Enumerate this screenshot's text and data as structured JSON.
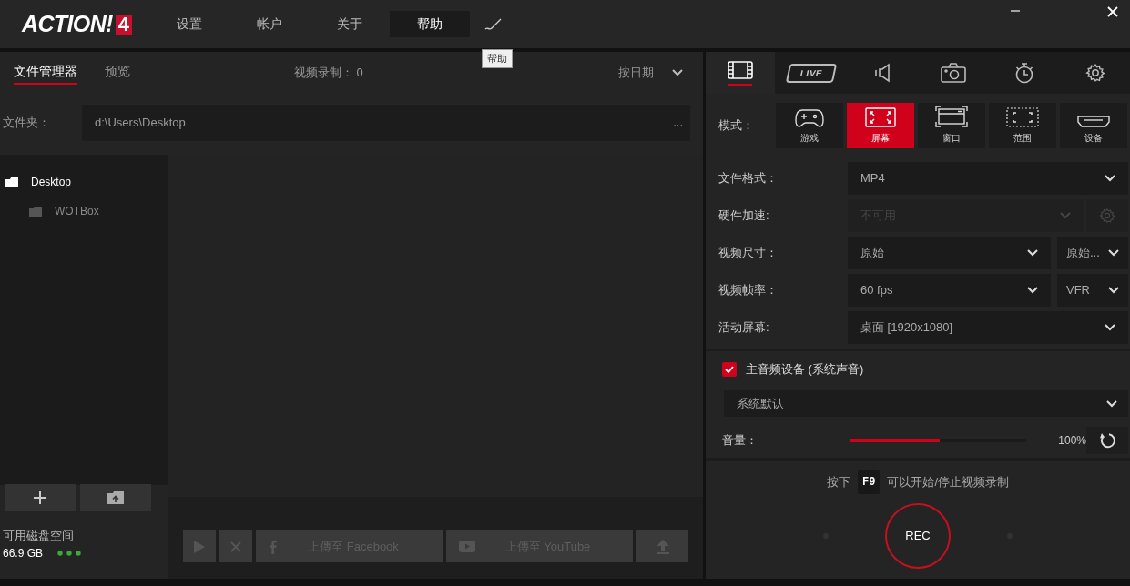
{
  "logo": {
    "text": "ACTION!",
    "badge": "4"
  },
  "menu": [
    {
      "label": "设置",
      "selected": false
    },
    {
      "label": "帐户",
      "selected": false
    },
    {
      "label": "关于",
      "selected": false
    },
    {
      "label": "帮助",
      "selected": true
    }
  ],
  "tooltip": "帮助",
  "file_panel": {
    "tabs": [
      {
        "label": "文件管理器",
        "selected": true
      },
      {
        "label": "预览",
        "selected": false
      }
    ],
    "record_count": "视频录制： 0",
    "sort": "按日期",
    "folder_label": "文件夹：",
    "folder_path": "d:\\Users\\Desktop",
    "browse": "...",
    "tree": [
      {
        "label": "Desktop",
        "selected": true,
        "children": [
          {
            "label": "WOTBox",
            "selected": false
          }
        ]
      }
    ],
    "disk_label": "可用磁盘空间",
    "disk_free": "66.9 GB",
    "upload_buttons": [
      {
        "kind": "facebook",
        "label": "上傳至 Facebook"
      },
      {
        "kind": "youtube",
        "label": "上傳至 YouTube"
      }
    ]
  },
  "settings": {
    "tabs": [
      {
        "kind": "video",
        "selected": true
      },
      {
        "kind": "live",
        "label": "LIVE",
        "selected": false
      },
      {
        "kind": "audio",
        "selected": false
      },
      {
        "kind": "camera",
        "selected": false
      },
      {
        "kind": "timer",
        "selected": false
      },
      {
        "kind": "settings",
        "selected": false
      }
    ],
    "mode_label": "模式：",
    "modes": [
      {
        "kind": "game",
        "label": "游戏",
        "selected": false
      },
      {
        "kind": "screen",
        "label": "屏幕",
        "selected": true
      },
      {
        "kind": "window",
        "label": "窗口",
        "selected": false
      },
      {
        "kind": "region",
        "label": "范围",
        "selected": false
      },
      {
        "kind": "device",
        "label": "设备",
        "selected": false
      }
    ],
    "rows": [
      {
        "kind": "single",
        "label": "文件格式：",
        "value": "MP4",
        "disabled": false
      },
      {
        "kind": "gear",
        "label": "硬件加速:",
        "value": "不可用",
        "disabled": true
      },
      {
        "kind": "pair",
        "label": "视频尺寸：",
        "value": "原始",
        "extra": "原始...",
        "disabled": false
      },
      {
        "kind": "pair",
        "label": "视频帧率：",
        "value": "60 fps",
        "extra": "VFR",
        "disabled": false
      },
      {
        "kind": "single",
        "label": "活动屏幕:",
        "value": "桌面 [1920x1080]",
        "disabled": false
      }
    ]
  },
  "audio": {
    "checked": true,
    "label": "主音频设备 (系统声音)",
    "device": "系统默认",
    "volume_label": "音量：",
    "level": 0.51,
    "volume": "100%"
  },
  "hotkey": {
    "before": "按下",
    "key": "F9",
    "after": "可以开始/停止视频录制"
  },
  "rec": "REC"
}
